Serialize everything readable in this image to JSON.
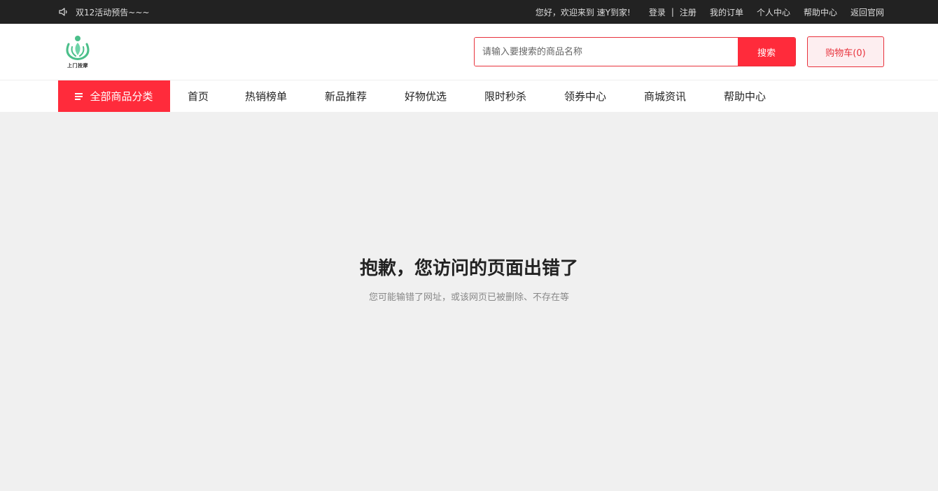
{
  "topbar": {
    "notice": "双12活动预告~~~",
    "welcome": "您好，欢迎来到 速Y到家!",
    "login": "登录",
    "separator": "|",
    "register": "注册",
    "links": [
      "我的订单",
      "个人中心",
      "帮助中心",
      "返回官网"
    ]
  },
  "header": {
    "logo_text": "上门按摩",
    "search_placeholder": "请输入要搜索的商品名称",
    "search_button": "搜索",
    "cart": "购物车(0)"
  },
  "nav": {
    "all_categories": "全部商品分类",
    "items": [
      "首页",
      "热销榜单",
      "新品推荐",
      "好物优选",
      "限时秒杀",
      "领券中心",
      "商城资讯",
      "帮助中心"
    ]
  },
  "error": {
    "title": "抱歉，您访问的页面出错了",
    "subtitle": "您可能输错了网址，或该网页已被删除、不存在等"
  },
  "colors": {
    "accent": "#ff2b3b",
    "topbar_bg": "#222222",
    "page_bg": "#f0f0f0",
    "logo_green": "#4bbf8a"
  },
  "icons": {
    "notice": "speaker-icon",
    "menu": "menu-icon"
  }
}
